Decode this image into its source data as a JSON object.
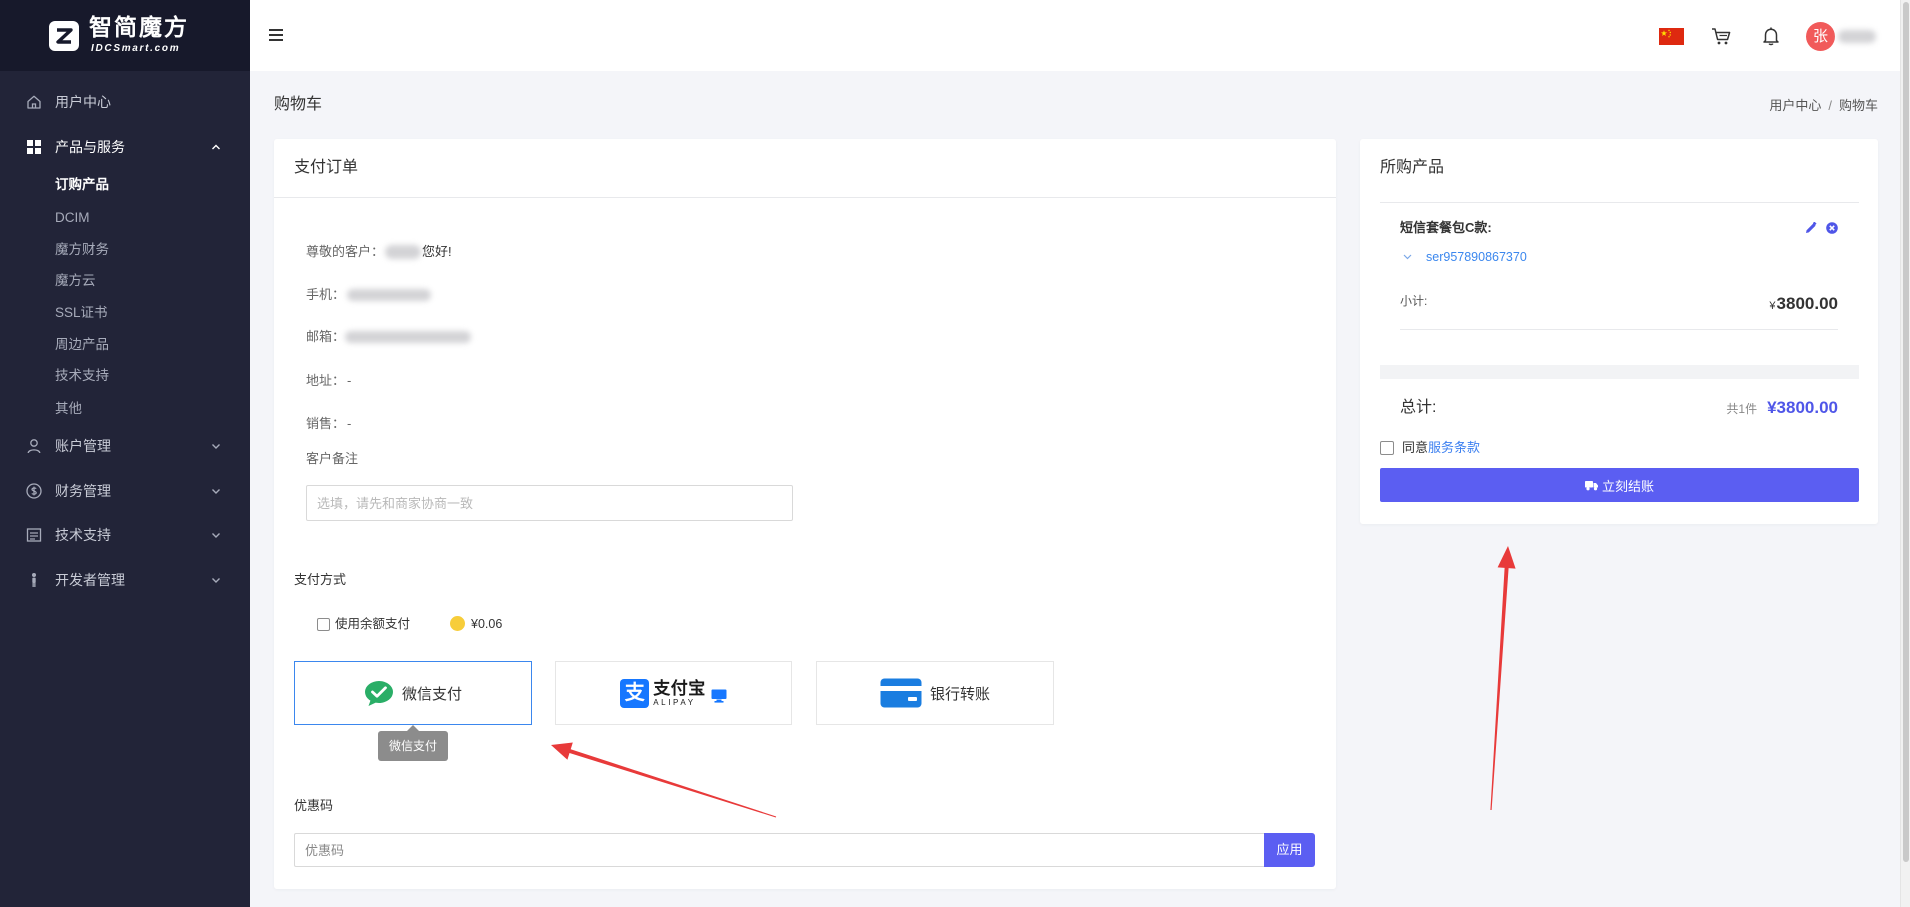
{
  "app": {
    "logo_name": "智简魔方",
    "logo_sub": "IDCSmart.com",
    "logo_icon": "idcsmart-logo-icon"
  },
  "sidebar": {
    "items": [
      {
        "label": "用户中心",
        "icon": "home-icon",
        "expanded": false
      },
      {
        "label": "产品与服务",
        "icon": "grid-icon",
        "expanded": true,
        "children": [
          "订购产品",
          "DCIM",
          "魔方财务",
          "魔方云",
          "SSL证书",
          "周边产品",
          "技术支持",
          "其他"
        ],
        "active_child_index": 0
      },
      {
        "label": "账户管理",
        "icon": "user-icon",
        "expanded": false
      },
      {
        "label": "财务管理",
        "icon": "dollar-icon",
        "expanded": false
      },
      {
        "label": "技术支持",
        "icon": "ticket-icon",
        "expanded": false
      },
      {
        "label": "开发者管理",
        "icon": "developer-icon",
        "expanded": false
      }
    ]
  },
  "header": {
    "icons": [
      "hamburger-icon",
      "china-flag-icon",
      "cart-icon",
      "bell-icon"
    ],
    "avatar_initial": "张"
  },
  "page": {
    "title": "购物车",
    "breadcrumb": [
      "用户中心",
      "购物车"
    ],
    "breadcrumb_separator": "/"
  },
  "order": {
    "title": "支付订单",
    "greeting_label": "尊敬的客户：",
    "greeting_suffix": "您好!",
    "phone_label": "手机：",
    "email_label": "邮箱：",
    "address_label": "地址：",
    "address_value": "-",
    "sales_label": "销售：",
    "sales_value": "-",
    "remark_label": "客户备注",
    "remark_placeholder": "选填，请先和商家协商一致",
    "payment_label": "支付方式",
    "balance_label": "使用余额支付",
    "balance_checked": false,
    "balance_amount": "¥0.06",
    "methods": [
      {
        "label": "微信支付",
        "icon": "wechat-pay-icon",
        "selected": true
      },
      {
        "logo_glyph": "支",
        "label": "支付宝",
        "sub": "ALIPAY",
        "icon": "alipay-icon",
        "selected": false
      },
      {
        "label": "银行转账",
        "icon": "bank-card-icon",
        "selected": false
      }
    ],
    "tooltip": "微信支付",
    "coupon_label": "优惠码",
    "coupon_placeholder": "优惠码",
    "coupon_apply": "应用"
  },
  "summary": {
    "title": "所购产品",
    "product_name": "短信套餐包C款:",
    "product_id": "ser957890867370",
    "subtotal_label": "小计:",
    "subtotal_currency": "¥",
    "subtotal_amount": "3800.00",
    "total_label": "总计:",
    "item_count": "共1件",
    "total_amount": "¥3800.00",
    "agree_prefix": "同意",
    "agree_link": "服务条款",
    "agree_checked": false,
    "checkout_label": "立刻结账"
  },
  "colors": {
    "primary": "#5b5ef2",
    "link": "#3b87ee",
    "sidebar": "#222438",
    "page_bg": "#f4f5f9",
    "wechat": "#2aae67",
    "alipay": "#1677ff",
    "annotation": "#e83a3a"
  }
}
